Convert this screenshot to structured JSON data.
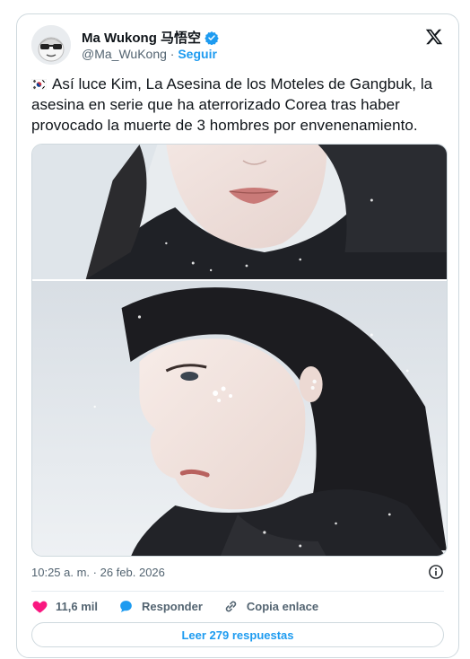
{
  "author": {
    "name": "Ma Wukong 马悟空",
    "handle": "@Ma_WuKong",
    "separator": "·",
    "follow_label": "Seguir",
    "verified_icon": "verified-badge-icon",
    "avatar_icon": "avatar-sunglasses-character"
  },
  "tweet": {
    "flag_icon": "south-korea-flag",
    "text": "Así luce Kim, La Asesina de los Moteles de Gangbuk, la asesina en serie que ha aterrorizado Corea tras haber provocado la muerte de 3 hombres por envenenamiento."
  },
  "media": {
    "images": [
      {
        "name": "photo-woman-lips-closeup"
      },
      {
        "name": "photo-woman-profile-snow"
      }
    ]
  },
  "meta": {
    "timestamp": "10:25 a. m. · 26 feb. 2026",
    "info_icon": "info-icon"
  },
  "actions": {
    "likes_count": "11,6 mil",
    "reply_label": "Responder",
    "copy_link_label": "Copia enlace"
  },
  "footer": {
    "read_replies_label": "Leer 279 respuestas"
  },
  "colors": {
    "accent": "#1d9bf0",
    "like": "#f91880",
    "muted": "#536471",
    "border": "#cfd9de"
  }
}
